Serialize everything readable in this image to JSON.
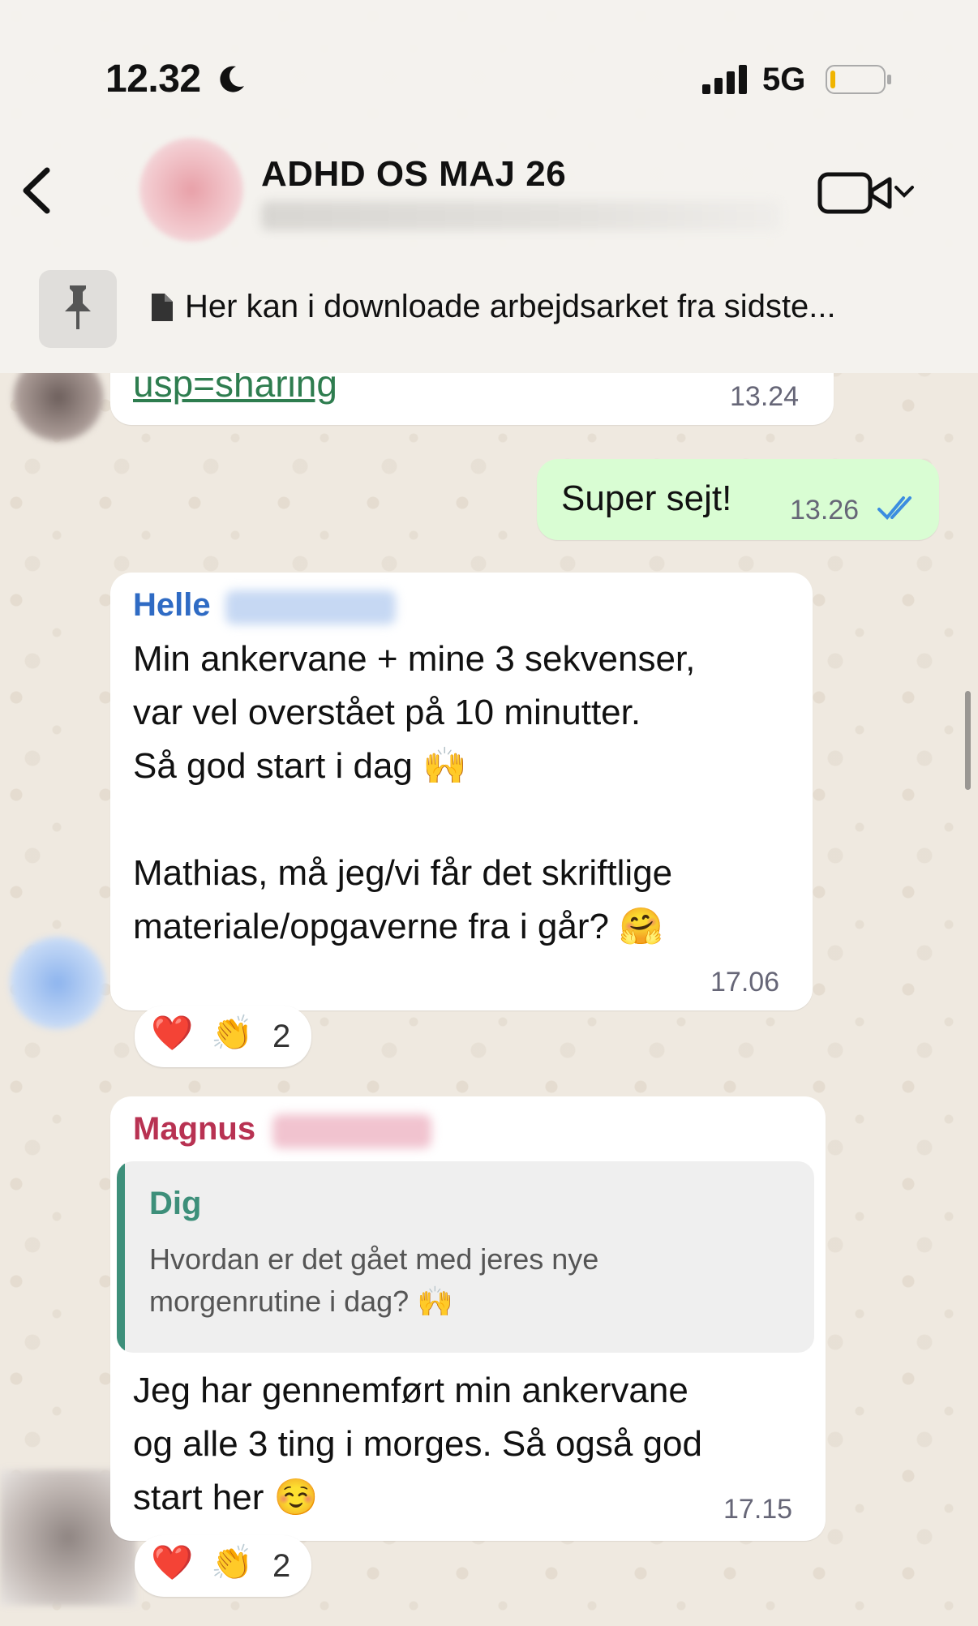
{
  "status_bar": {
    "time": "12.32",
    "network": "5G"
  },
  "header": {
    "back_icon": "chevron-left-icon",
    "chat_title": "ADHD OS MAJ 26",
    "video_icon": "video-call-icon"
  },
  "pinned": {
    "text": "Her kan i downloade arbejdsarket fra sidste..."
  },
  "messages": [
    {
      "type": "incoming-partial",
      "link_text": "usp=sharing",
      "time": "13.24"
    },
    {
      "type": "outgoing",
      "text": "Super sejt!",
      "time": "13.26",
      "status": "read"
    },
    {
      "type": "incoming",
      "sender": "Helle",
      "sender_color": "#2f6bc4",
      "lines": [
        "Min ankervane + mine 3 sekvenser,",
        "var vel overstået på 10 minutter.",
        "Så god start i dag 🙌",
        "",
        "Mathias, må jeg/vi får det skriftlige",
        "materiale/opgaverne  fra i går? 🤗"
      ],
      "time": "17.06",
      "reactions": {
        "emojis": [
          "❤️",
          "👏"
        ],
        "count": "2"
      }
    },
    {
      "type": "incoming",
      "sender": "Magnus",
      "sender_color": "#b83252",
      "quote": {
        "name": "Dig",
        "lines": [
          "Hvordan er det gået med jeres nye",
          "morgenrutine i dag? 🙌"
        ]
      },
      "lines": [
        "Jeg har gennemført min ankervane",
        "og alle 3 ting i morges. Så også god",
        "start her ☺️"
      ],
      "time": "17.15",
      "reactions": {
        "emojis": [
          "❤️",
          "👏"
        ],
        "count": "2"
      }
    }
  ],
  "colors": {
    "outgoing_bubble": "#d9fdd3",
    "incoming_bubble": "#ffffff",
    "read_tick": "#3b8de0",
    "link": "#2e7d4f"
  }
}
